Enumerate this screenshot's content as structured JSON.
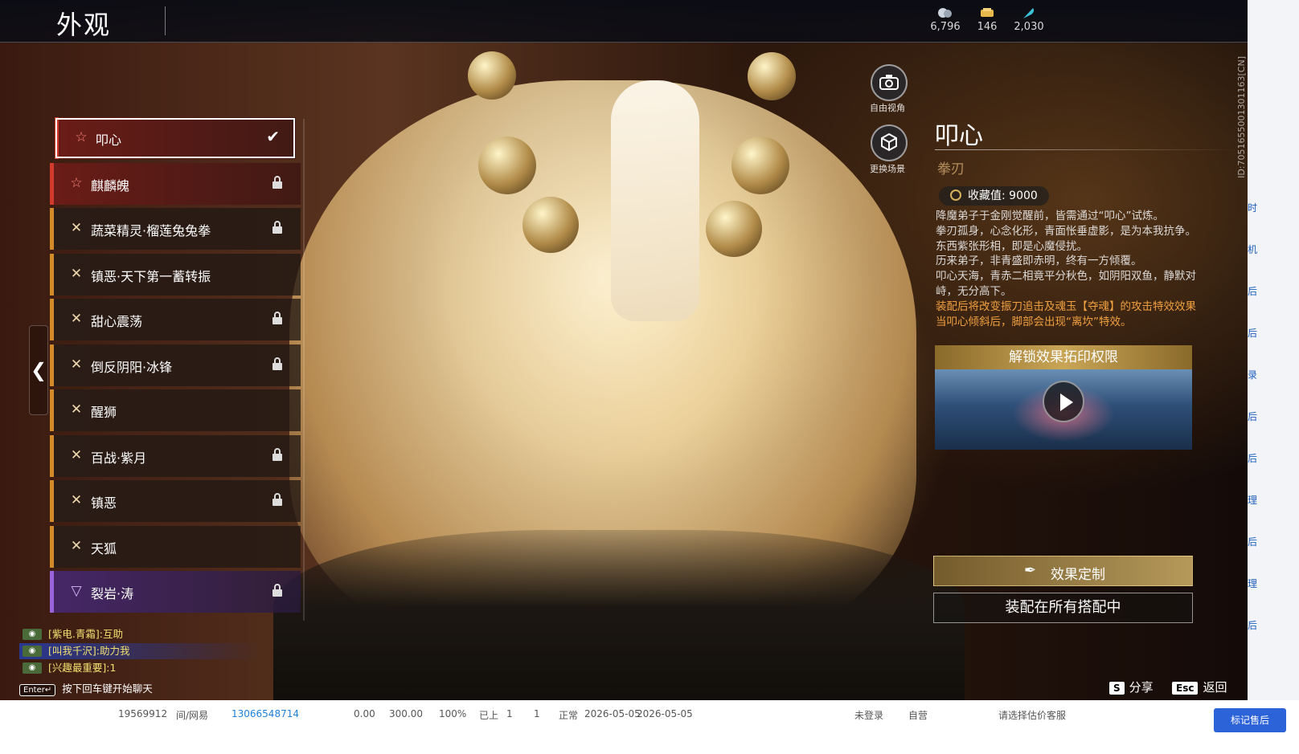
{
  "header": {
    "title": "外观",
    "currencies": [
      {
        "icon": "jade-icon",
        "value": "6,796"
      },
      {
        "icon": "ticket-icon",
        "value": "146"
      },
      {
        "icon": "feather-icon",
        "value": "2,030"
      }
    ]
  },
  "player_id": "ID:7051655001301163[CN]",
  "skin_list": [
    {
      "name": "叩心",
      "rarity": "red",
      "icon": "star-icon",
      "selected": true,
      "locked": false
    },
    {
      "name": "麒麟魄",
      "rarity": "red",
      "icon": "star-icon",
      "selected": false,
      "locked": true
    },
    {
      "name": "蔬菜精灵·榴莲兔兔拳",
      "rarity": "orange",
      "icon": "cross-icon",
      "selected": false,
      "locked": true
    },
    {
      "name": "镇恶·天下第一蓄转振",
      "rarity": "orange",
      "icon": "cross-icon",
      "selected": false,
      "locked": false
    },
    {
      "name": "甜心震荡",
      "rarity": "orange",
      "icon": "cross-icon",
      "selected": false,
      "locked": true
    },
    {
      "name": "倒反阴阳·冰锋",
      "rarity": "orange",
      "icon": "cross-icon",
      "selected": false,
      "locked": true
    },
    {
      "name": "醒狮",
      "rarity": "orange",
      "icon": "cross-icon",
      "selected": false,
      "locked": false
    },
    {
      "name": "百战·紫月",
      "rarity": "orange",
      "icon": "cross-icon",
      "selected": false,
      "locked": true
    },
    {
      "name": "镇恶",
      "rarity": "orange",
      "icon": "cross-icon",
      "selected": false,
      "locked": true
    },
    {
      "name": "天狐",
      "rarity": "orange",
      "icon": "cross-icon",
      "selected": false,
      "locked": false
    },
    {
      "name": "裂岩·涛",
      "rarity": "purple",
      "icon": "chevron-icon",
      "selected": false,
      "locked": true
    }
  ],
  "camera": {
    "free_view": "自由视角",
    "change_scene": "更换场景"
  },
  "detail": {
    "title": "叩心",
    "subtitle": "拳刃",
    "collection_label": "收藏值:",
    "collection_value": "9000",
    "desc": [
      "降魔弟子于金刚觉醒前，皆需通过“叩心”试炼。",
      "拳刃孤身，心念化形，青面怅垂虚影，是为本我抗争。",
      "东西紫张形相，即是心魔侵扰。",
      "历来弟子，非青盛即赤明，终有一方倾覆。",
      "叩心天海，青赤二相竟平分秋色，如阴阳双鱼，静默对峙，无分高下。"
    ],
    "effect_desc": [
      "装配后将改变振刀追击及魂玉【夺魂】的攻击特效效果",
      "当叩心倾斜后，脚部会出现“离坎”特效。"
    ],
    "unlock_title": "解锁效果拓印权限",
    "effect_button": "效果定制",
    "equip_button": "装配在所有搭配中"
  },
  "chat": [
    {
      "text": "[紫电.青霜]:互助",
      "highlight": false
    },
    {
      "text": "[叫我千沢]:助力我",
      "highlight": true
    },
    {
      "text": "[兴趣最重要]:1",
      "highlight": false
    }
  ],
  "chat_hint": {
    "key": "Enter↵",
    "text": "按下回车键开始聊天"
  },
  "hotkeys": [
    {
      "key": "S",
      "label": "分享"
    },
    {
      "key": "Esc",
      "label": "返回"
    }
  ],
  "underlying_page": {
    "row": [
      "19569912",
      "间/网易",
      "13066548714",
      "0.00",
      "300.00",
      "100%",
      "已上",
      "1",
      "1",
      "正常",
      "2026-05-05",
      "2026-05-05",
      "未登录",
      "自营",
      "请选择估价客服"
    ],
    "side_button": "标记售后",
    "side_tags": [
      "时",
      "机",
      "后",
      "后",
      "录",
      "后",
      "后",
      "理",
      "后",
      "理",
      "后"
    ]
  }
}
